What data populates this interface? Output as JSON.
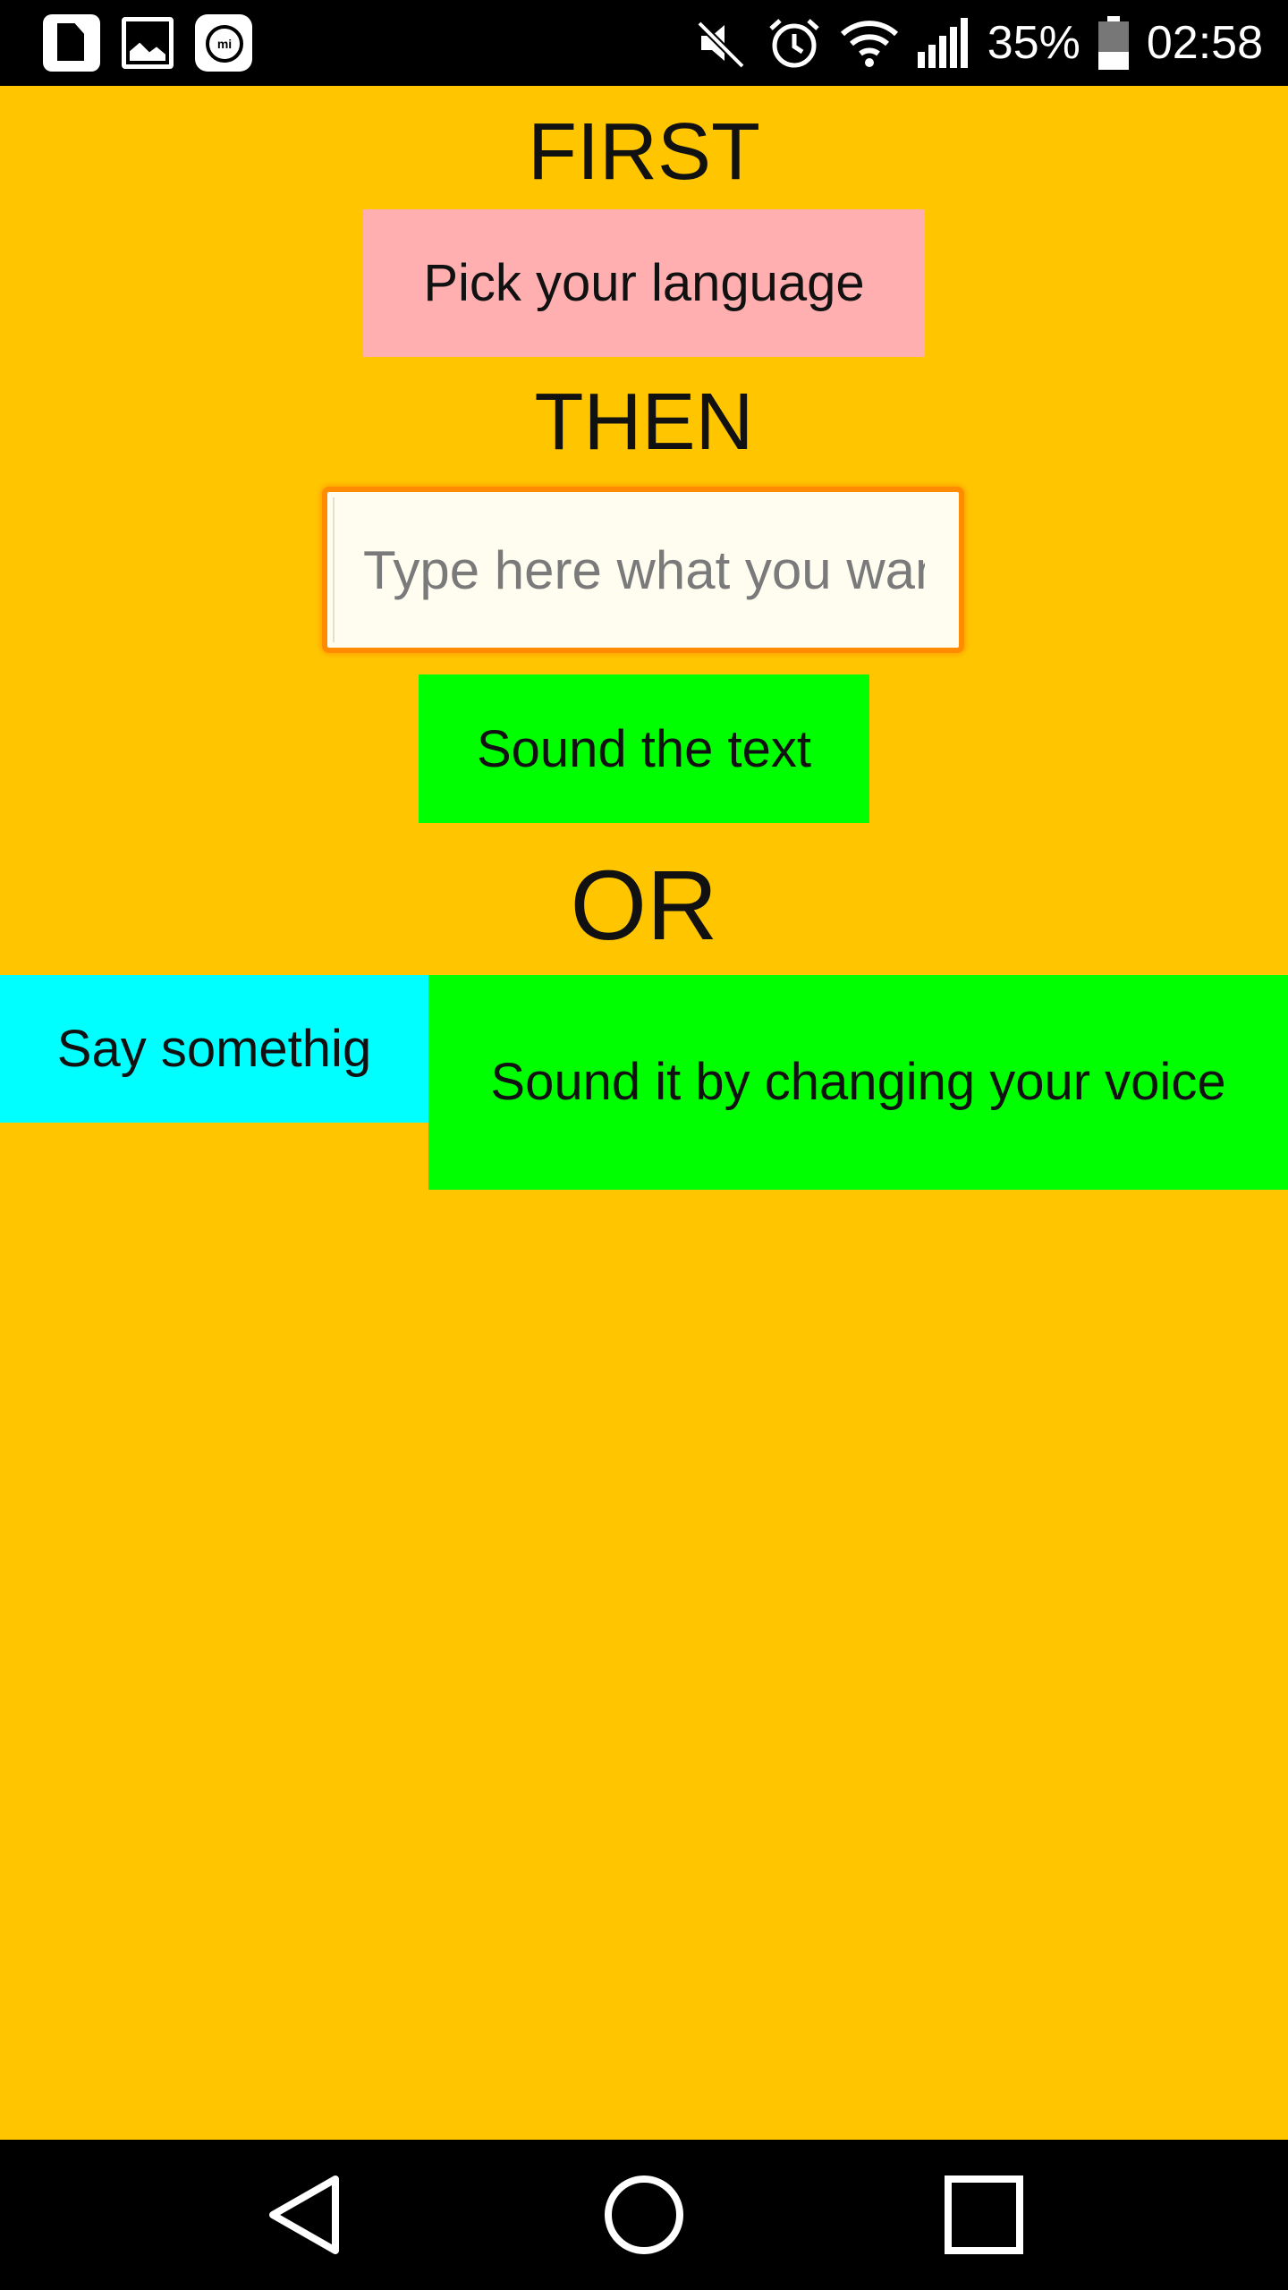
{
  "status_bar": {
    "battery_percent": "35%",
    "time": "02:58",
    "icons": [
      "sim-icon",
      "gallery-icon",
      "mi-icon",
      "mute-icon",
      "alarm-icon",
      "wifi-icon",
      "signal-icon",
      "battery-icon"
    ]
  },
  "main": {
    "first_label": "FIRST",
    "pick_language_button": "Pick your language",
    "then_label": "THEN",
    "text_input": {
      "value": "",
      "placeholder": "Type here what you want"
    },
    "sound_text_button": "Sound the text",
    "or_label": "OR",
    "say_something_button": "Say somethig",
    "change_voice_button": "Sound it by changing your voice"
  },
  "colors": {
    "background": "#FFC600",
    "pick_language_button": "#FFAFAF",
    "sound_button": "#00FF00",
    "say_button": "#00FFFF",
    "input_border": "#FF8C00"
  },
  "nav_bar": {
    "icons": [
      "back-icon",
      "home-icon",
      "recents-icon"
    ]
  }
}
